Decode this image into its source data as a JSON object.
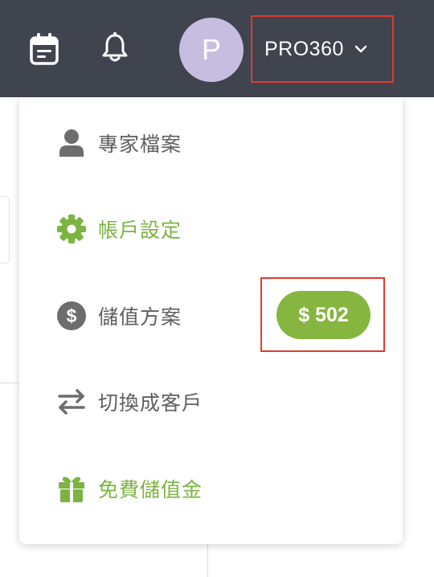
{
  "header": {
    "avatar_initial": "P",
    "account_name": "PRO360",
    "icons": {
      "calendar": "calendar-icon",
      "bell": "bell-icon",
      "chevron": "chevron-down-icon"
    }
  },
  "menu": {
    "items": [
      {
        "label": "專家檔案",
        "icon": "user-icon",
        "color": "#5f5f5f"
      },
      {
        "label": "帳戶設定",
        "icon": "gear-icon",
        "color": "#7cb342"
      },
      {
        "label": "儲值方案",
        "icon": "dollar-circle-icon",
        "color": "#5f5f5f"
      },
      {
        "label": "切換成客戶",
        "icon": "swap-arrows-icon",
        "color": "#5f5f5f"
      },
      {
        "label": "免費儲值金",
        "icon": "gift-icon",
        "color": "#7cb342"
      }
    ],
    "balance": "$ 502"
  },
  "colors": {
    "topbar": "#40444f",
    "accent_green": "#7cb342",
    "highlight_red": "#e03b2e",
    "avatar": "#c7bde0"
  }
}
